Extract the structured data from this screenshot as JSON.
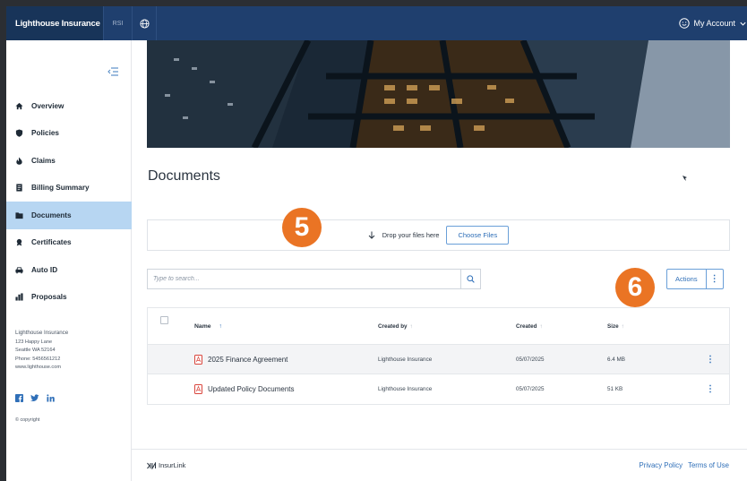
{
  "topbar": {
    "brand": "Lighthouse Insurance",
    "brand_sub": "RSI",
    "account_label": "My Account"
  },
  "sidebar": {
    "items": [
      {
        "label": "Overview",
        "icon": "home-icon",
        "active": false
      },
      {
        "label": "Policies",
        "icon": "shield-icon",
        "active": false
      },
      {
        "label": "Claims",
        "icon": "fire-icon",
        "active": false
      },
      {
        "label": "Billing Summary",
        "icon": "invoice-icon",
        "active": false
      },
      {
        "label": "Documents",
        "icon": "folder-icon",
        "active": true
      },
      {
        "label": "Certificates",
        "icon": "certificate-icon",
        "active": false
      },
      {
        "label": "Auto ID",
        "icon": "car-icon",
        "active": false
      },
      {
        "label": "Proposals",
        "icon": "chart-icon",
        "active": false
      }
    ],
    "address": {
      "company": "Lighthouse Insurance",
      "street": "123 Happy Lane",
      "city": "Seattle WA 52164",
      "phone": "Phone: 5456561212",
      "web": "www.lighthouse.com"
    },
    "copyright": "© copyright"
  },
  "main": {
    "title": "Documents",
    "dropzone": {
      "text": "Drop your files here",
      "button": "Choose Files"
    },
    "search": {
      "placeholder": "Type to search..."
    },
    "actions_label": "Actions",
    "table": {
      "headers": {
        "name": "Name",
        "created_by": "Created by",
        "created": "Created",
        "size": "Size"
      },
      "rows": [
        {
          "name": "2025 Finance Agreement",
          "created_by": "Lighthouse Insurance",
          "created": "05/07/2025",
          "size": "6.4 MB"
        },
        {
          "name": "Updated Policy Documents",
          "created_by": "Lighthouse Insurance",
          "created": "05/07/2025",
          "size": "51 KB"
        }
      ]
    }
  },
  "badges": {
    "step5": "5",
    "step6": "6"
  },
  "footer": {
    "brand": "InsurLink",
    "links": [
      "Privacy Policy",
      "Terms of Use"
    ]
  },
  "colors": {
    "topbar": "#1f3f6e",
    "active_nav": "#b7d6f2",
    "accent": "#2f6fb8",
    "badge": "#ea7424"
  }
}
